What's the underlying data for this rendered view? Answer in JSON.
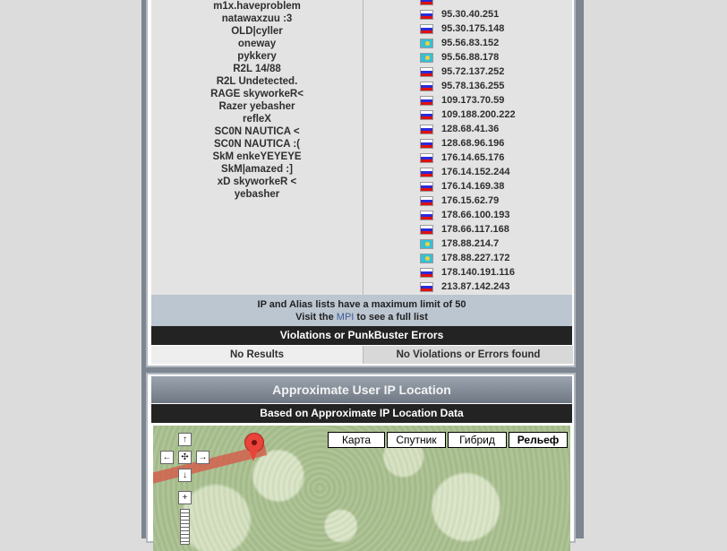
{
  "aliases": [
    "m1x.haveproblem",
    "natawaxzuu :3",
    "OLD|cyller",
    "oneway",
    "pykkery",
    "R2L 14/88",
    "R2L Undetected.",
    "RAGE skyworkeR<",
    "Razer yebasher",
    "refleX",
    "SC0N NAUTICA <",
    "SC0N NAUTICA :(",
    "SkM enkeYEYEYE",
    "SkM|amazed :]",
    "xD skyworkeR <",
    "yebasher"
  ],
  "ips": [
    {
      "flag": "ru",
      "ip": ""
    },
    {
      "flag": "ru",
      "ip": "95.30.40.251"
    },
    {
      "flag": "ru",
      "ip": "95.30.175.148"
    },
    {
      "flag": "kz",
      "ip": "95.56.83.152"
    },
    {
      "flag": "kz",
      "ip": "95.56.88.178"
    },
    {
      "flag": "ru",
      "ip": "95.72.137.252"
    },
    {
      "flag": "ru",
      "ip": "95.78.136.255"
    },
    {
      "flag": "ru",
      "ip": "109.173.70.59"
    },
    {
      "flag": "ru",
      "ip": "109.188.200.222"
    },
    {
      "flag": "ru",
      "ip": "128.68.41.36"
    },
    {
      "flag": "ru",
      "ip": "128.68.96.196"
    },
    {
      "flag": "ru",
      "ip": "176.14.65.176"
    },
    {
      "flag": "ru",
      "ip": "176.14.152.244"
    },
    {
      "flag": "ru",
      "ip": "176.14.169.38"
    },
    {
      "flag": "ru",
      "ip": "176.15.62.79"
    },
    {
      "flag": "ru",
      "ip": "178.66.100.193"
    },
    {
      "flag": "ru",
      "ip": "178.66.117.168"
    },
    {
      "flag": "kz",
      "ip": "178.88.214.7"
    },
    {
      "flag": "kz",
      "ip": "178.88.227.172"
    },
    {
      "flag": "ru",
      "ip": "178.140.191.116"
    },
    {
      "flag": "ru",
      "ip": "213.87.142.243"
    }
  ],
  "limit_notice": {
    "line1": "IP and Alias lists have a maximum limit of 50",
    "prefix": "Visit the",
    "link": "MPI",
    "suffix": "to see a full list"
  },
  "violations": {
    "header": "Violations or PunkBuster Errors",
    "left": "No Results",
    "right": "No Violations or Errors found"
  },
  "location": {
    "title": "Approximate User IP Location",
    "subheader": "Based on Approximate IP Location Data"
  },
  "map": {
    "types": [
      "Карта",
      "Спутник",
      "Гибрид",
      "Рельеф"
    ],
    "controls": {
      "up": "↑",
      "left": "←",
      "center": "✣",
      "right": "→",
      "down": "↓",
      "zoom_in": "+"
    }
  },
  "colors": {
    "frame": "#7c8590",
    "header_dark": "#232323",
    "notice_bg": "#bcc6d0",
    "link": "#3b5b9a",
    "marker": "#e8443a"
  }
}
